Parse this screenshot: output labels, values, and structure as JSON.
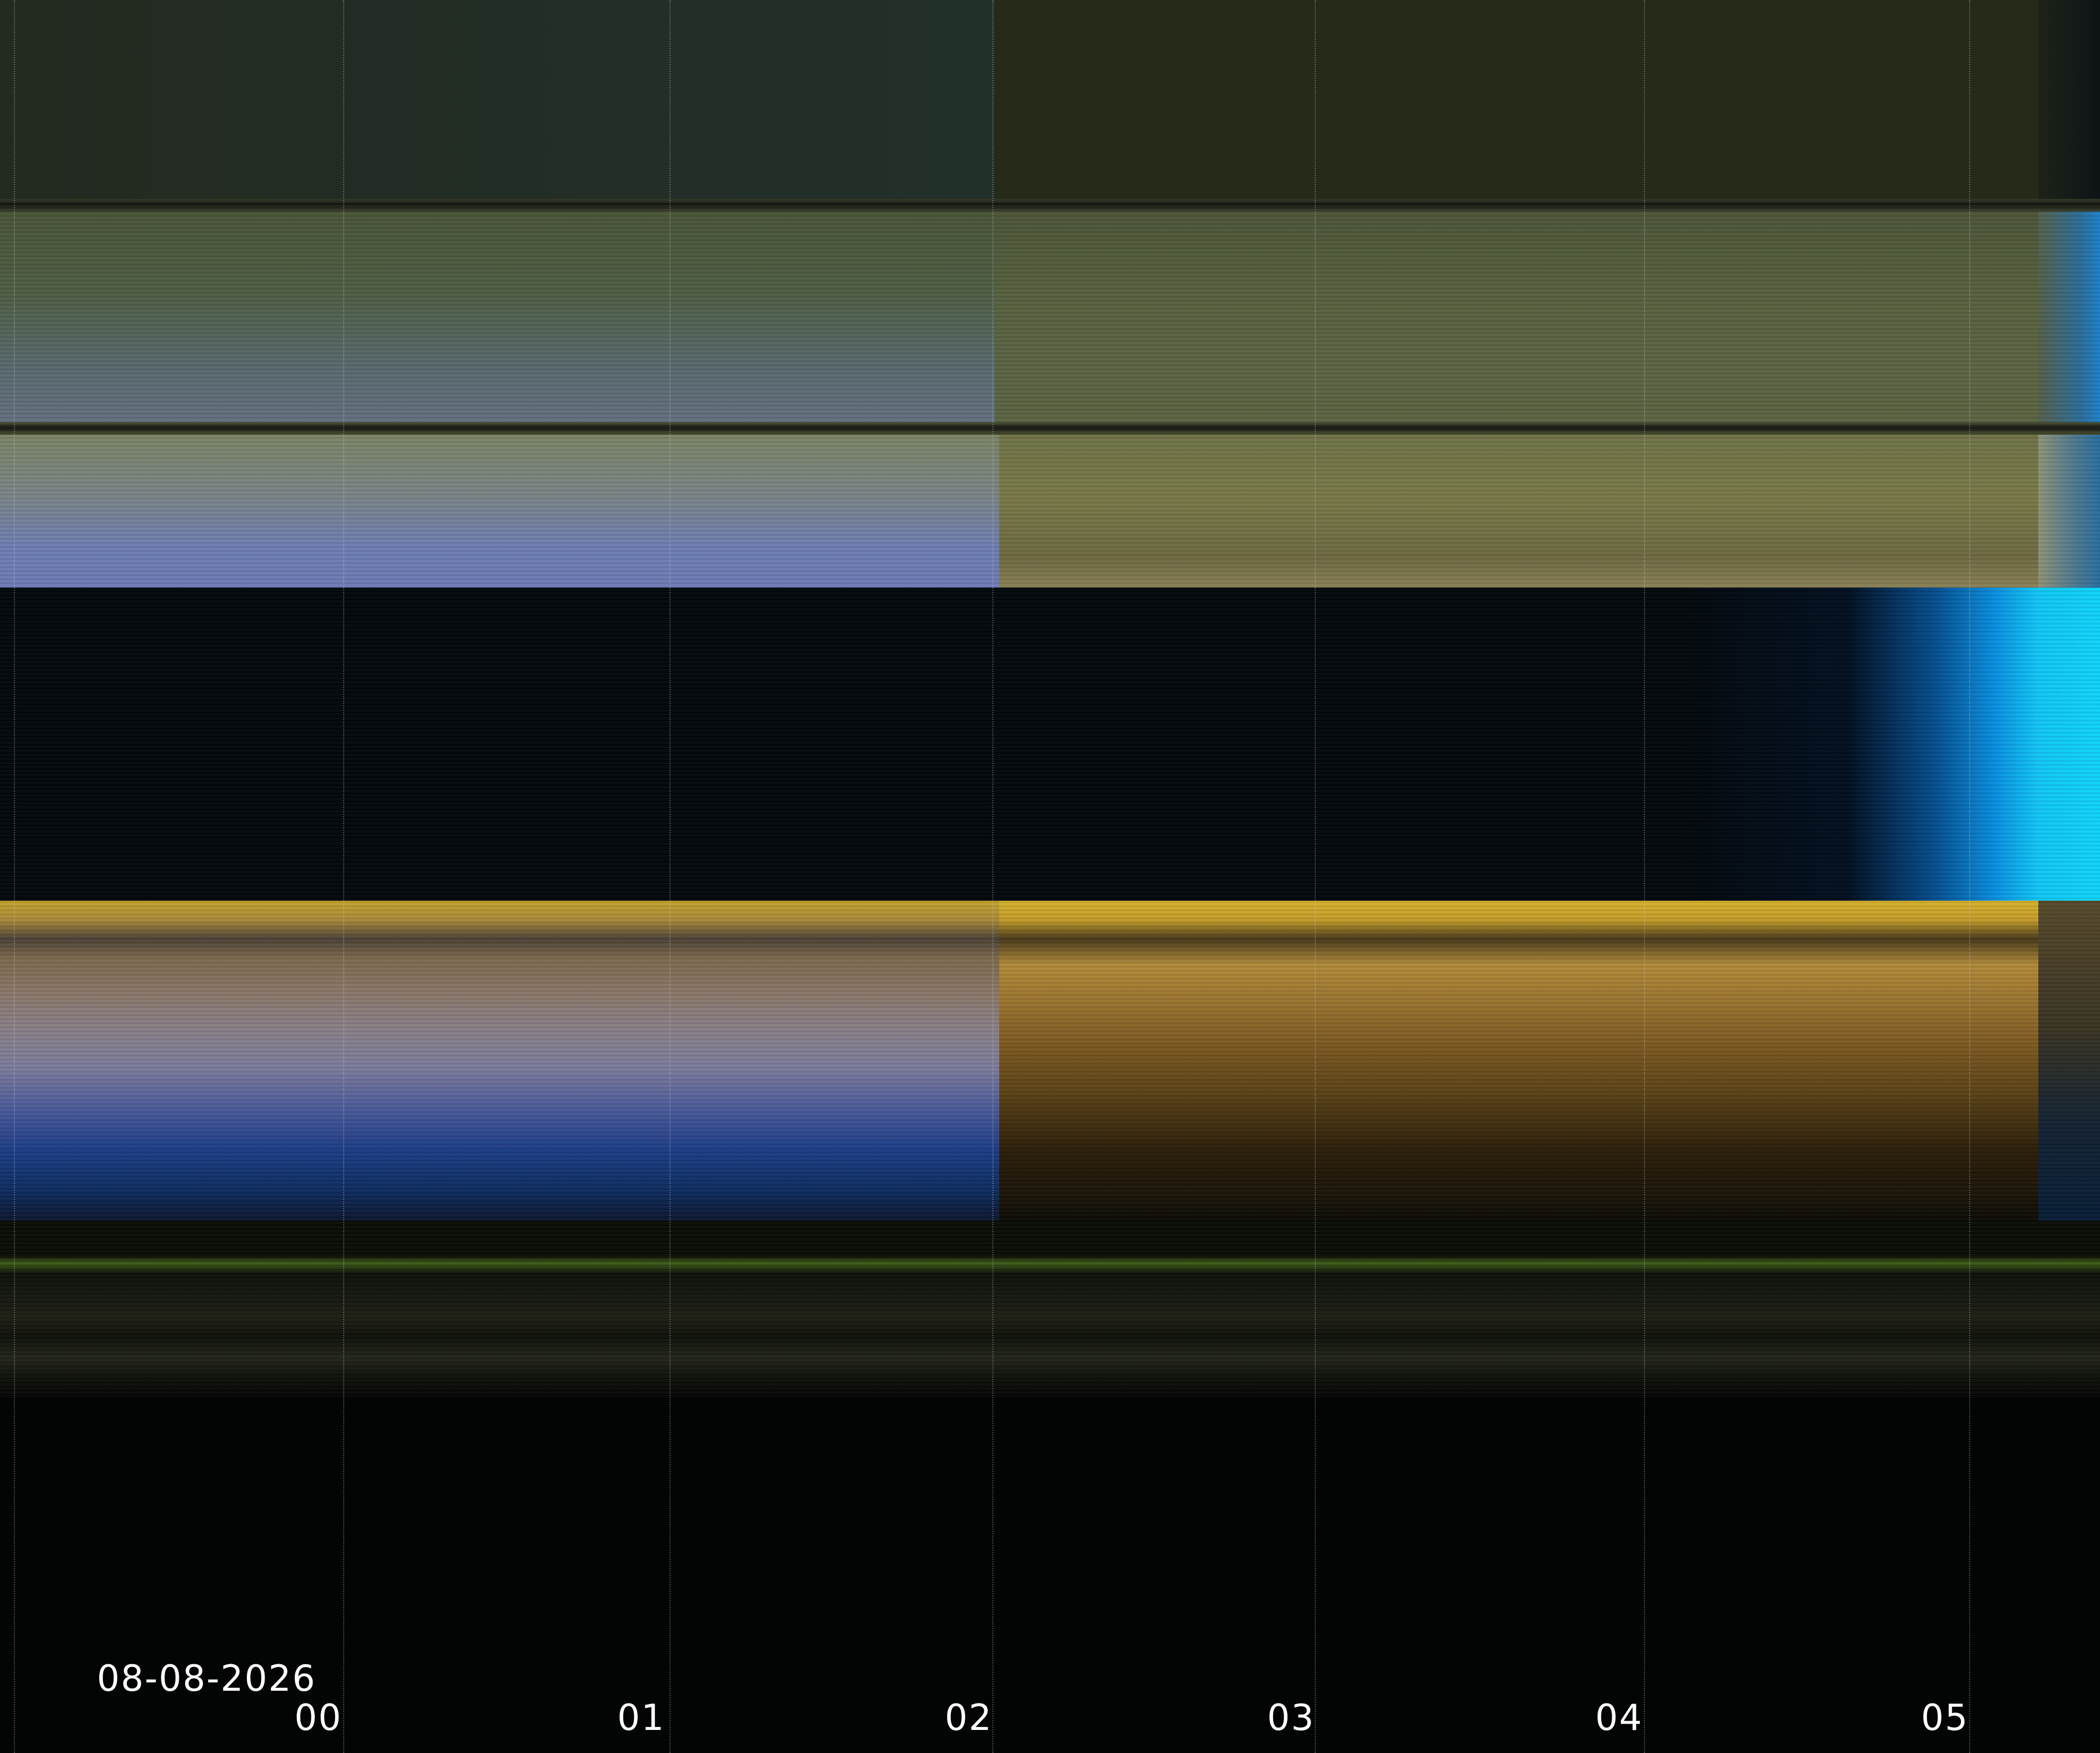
{
  "date": "08-08-2026",
  "hours": [
    "00",
    "01",
    "02",
    "03",
    "04",
    "05"
  ]
}
